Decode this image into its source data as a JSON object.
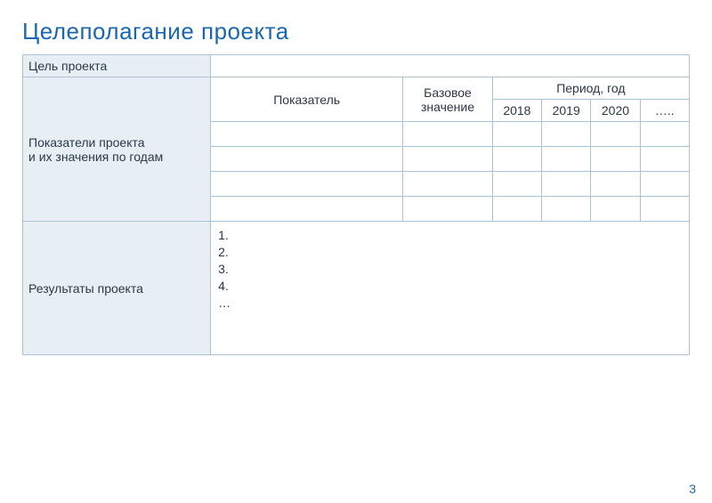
{
  "title": "Целеполагание проекта",
  "row_goal": {
    "label": "Цель проекта",
    "value": ""
  },
  "row_indicators": {
    "label": "Показатели проекта\nи их значения по годам",
    "indicator_header": "Показатель",
    "base_header": "Базовое значение",
    "period_header": "Период, год",
    "years": [
      "2018",
      "2019",
      "2020",
      "….."
    ],
    "rows": [
      {
        "indicator": "",
        "base": "",
        "values": [
          "",
          "",
          "",
          ""
        ]
      },
      {
        "indicator": "",
        "base": "",
        "values": [
          "",
          "",
          "",
          ""
        ]
      },
      {
        "indicator": "",
        "base": "",
        "values": [
          "",
          "",
          "",
          ""
        ]
      },
      {
        "indicator": "",
        "base": "",
        "values": [
          "",
          "",
          "",
          ""
        ]
      }
    ]
  },
  "row_results": {
    "label": "Результаты проекта",
    "items": [
      "1.",
      "2.",
      "3.",
      "4.",
      "…"
    ]
  },
  "page_number": "3"
}
